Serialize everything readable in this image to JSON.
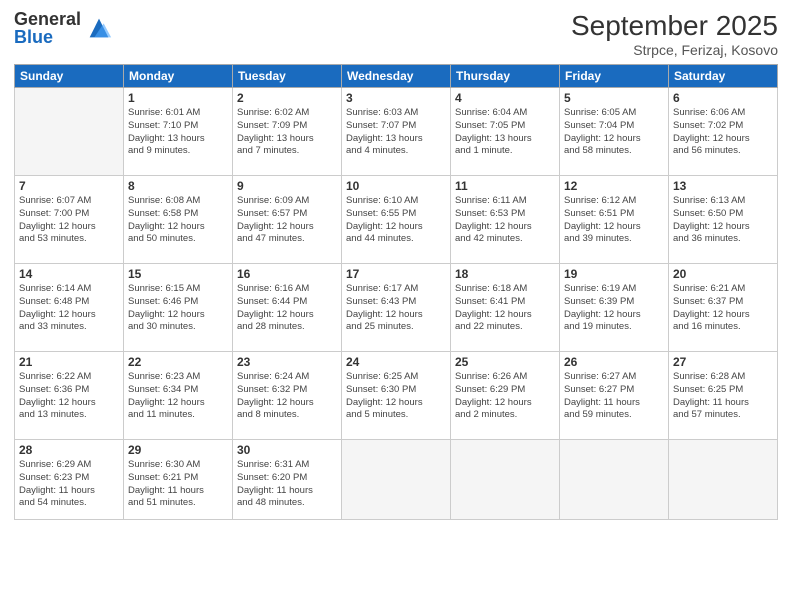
{
  "logo": {
    "general": "General",
    "blue": "Blue"
  },
  "title": "September 2025",
  "location": "Strpce, Ferizaj, Kosovo",
  "days_header": [
    "Sunday",
    "Monday",
    "Tuesday",
    "Wednesday",
    "Thursday",
    "Friday",
    "Saturday"
  ],
  "weeks": [
    [
      {
        "day": "",
        "info": ""
      },
      {
        "day": "1",
        "info": "Sunrise: 6:01 AM\nSunset: 7:10 PM\nDaylight: 13 hours\nand 9 minutes."
      },
      {
        "day": "2",
        "info": "Sunrise: 6:02 AM\nSunset: 7:09 PM\nDaylight: 13 hours\nand 7 minutes."
      },
      {
        "day": "3",
        "info": "Sunrise: 6:03 AM\nSunset: 7:07 PM\nDaylight: 13 hours\nand 4 minutes."
      },
      {
        "day": "4",
        "info": "Sunrise: 6:04 AM\nSunset: 7:05 PM\nDaylight: 13 hours\nand 1 minute."
      },
      {
        "day": "5",
        "info": "Sunrise: 6:05 AM\nSunset: 7:04 PM\nDaylight: 12 hours\nand 58 minutes."
      },
      {
        "day": "6",
        "info": "Sunrise: 6:06 AM\nSunset: 7:02 PM\nDaylight: 12 hours\nand 56 minutes."
      }
    ],
    [
      {
        "day": "7",
        "info": "Sunrise: 6:07 AM\nSunset: 7:00 PM\nDaylight: 12 hours\nand 53 minutes."
      },
      {
        "day": "8",
        "info": "Sunrise: 6:08 AM\nSunset: 6:58 PM\nDaylight: 12 hours\nand 50 minutes."
      },
      {
        "day": "9",
        "info": "Sunrise: 6:09 AM\nSunset: 6:57 PM\nDaylight: 12 hours\nand 47 minutes."
      },
      {
        "day": "10",
        "info": "Sunrise: 6:10 AM\nSunset: 6:55 PM\nDaylight: 12 hours\nand 44 minutes."
      },
      {
        "day": "11",
        "info": "Sunrise: 6:11 AM\nSunset: 6:53 PM\nDaylight: 12 hours\nand 42 minutes."
      },
      {
        "day": "12",
        "info": "Sunrise: 6:12 AM\nSunset: 6:51 PM\nDaylight: 12 hours\nand 39 minutes."
      },
      {
        "day": "13",
        "info": "Sunrise: 6:13 AM\nSunset: 6:50 PM\nDaylight: 12 hours\nand 36 minutes."
      }
    ],
    [
      {
        "day": "14",
        "info": "Sunrise: 6:14 AM\nSunset: 6:48 PM\nDaylight: 12 hours\nand 33 minutes."
      },
      {
        "day": "15",
        "info": "Sunrise: 6:15 AM\nSunset: 6:46 PM\nDaylight: 12 hours\nand 30 minutes."
      },
      {
        "day": "16",
        "info": "Sunrise: 6:16 AM\nSunset: 6:44 PM\nDaylight: 12 hours\nand 28 minutes."
      },
      {
        "day": "17",
        "info": "Sunrise: 6:17 AM\nSunset: 6:43 PM\nDaylight: 12 hours\nand 25 minutes."
      },
      {
        "day": "18",
        "info": "Sunrise: 6:18 AM\nSunset: 6:41 PM\nDaylight: 12 hours\nand 22 minutes."
      },
      {
        "day": "19",
        "info": "Sunrise: 6:19 AM\nSunset: 6:39 PM\nDaylight: 12 hours\nand 19 minutes."
      },
      {
        "day": "20",
        "info": "Sunrise: 6:21 AM\nSunset: 6:37 PM\nDaylight: 12 hours\nand 16 minutes."
      }
    ],
    [
      {
        "day": "21",
        "info": "Sunrise: 6:22 AM\nSunset: 6:36 PM\nDaylight: 12 hours\nand 13 minutes."
      },
      {
        "day": "22",
        "info": "Sunrise: 6:23 AM\nSunset: 6:34 PM\nDaylight: 12 hours\nand 11 minutes."
      },
      {
        "day": "23",
        "info": "Sunrise: 6:24 AM\nSunset: 6:32 PM\nDaylight: 12 hours\nand 8 minutes."
      },
      {
        "day": "24",
        "info": "Sunrise: 6:25 AM\nSunset: 6:30 PM\nDaylight: 12 hours\nand 5 minutes."
      },
      {
        "day": "25",
        "info": "Sunrise: 6:26 AM\nSunset: 6:29 PM\nDaylight: 12 hours\nand 2 minutes."
      },
      {
        "day": "26",
        "info": "Sunrise: 6:27 AM\nSunset: 6:27 PM\nDaylight: 11 hours\nand 59 minutes."
      },
      {
        "day": "27",
        "info": "Sunrise: 6:28 AM\nSunset: 6:25 PM\nDaylight: 11 hours\nand 57 minutes."
      }
    ],
    [
      {
        "day": "28",
        "info": "Sunrise: 6:29 AM\nSunset: 6:23 PM\nDaylight: 11 hours\nand 54 minutes."
      },
      {
        "day": "29",
        "info": "Sunrise: 6:30 AM\nSunset: 6:21 PM\nDaylight: 11 hours\nand 51 minutes."
      },
      {
        "day": "30",
        "info": "Sunrise: 6:31 AM\nSunset: 6:20 PM\nDaylight: 11 hours\nand 48 minutes."
      },
      {
        "day": "",
        "info": ""
      },
      {
        "day": "",
        "info": ""
      },
      {
        "day": "",
        "info": ""
      },
      {
        "day": "",
        "info": ""
      }
    ]
  ]
}
